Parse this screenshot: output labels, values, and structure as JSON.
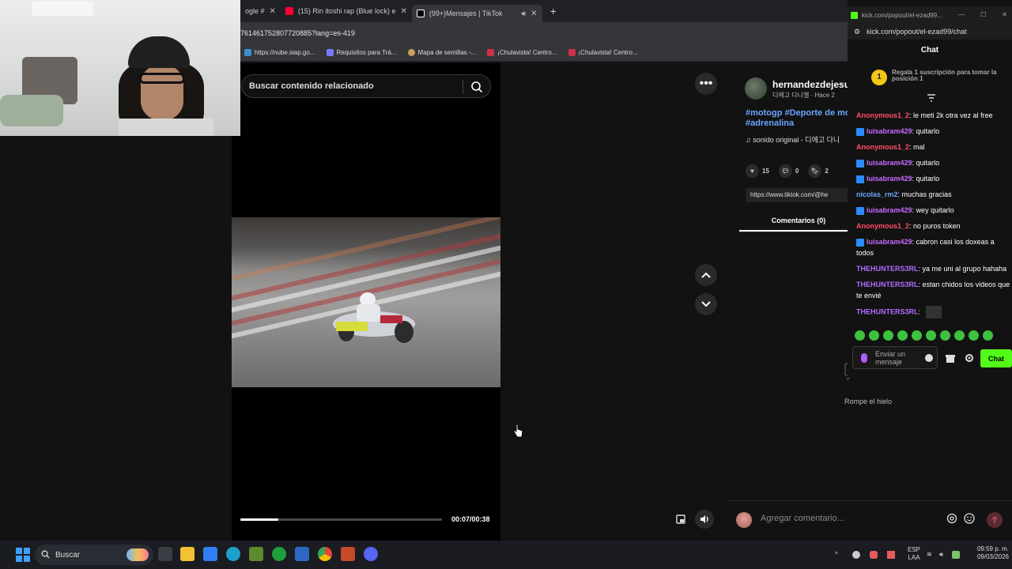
{
  "browser": {
    "tabs": [
      {
        "label": "ogle #",
        "icon": "google-icon",
        "color": "#4285f4"
      },
      {
        "label": "(15) Rin itoshi rap (Blue lock) e",
        "icon": "youtube-icon",
        "color": "#ff0033"
      },
      {
        "label": "(99+)Mensajes | TikTok",
        "icon": "tiktok-icon",
        "color": "#ffffff",
        "active": true
      }
    ],
    "url": "761461752807720885?lang=es-419",
    "bookmarks": [
      {
        "label": "https://nube.siap.go...",
        "color": "#3b8fd0"
      },
      {
        "label": "Requisitos para Trá...",
        "color": "#7a7aff"
      },
      {
        "label": "Mapa de semillas -...",
        "color": "#c8a25a"
      },
      {
        "label": "¡Chulavista! Centro...",
        "color": "#d0304a"
      },
      {
        "label": "¡Chulavista! Centro...",
        "color": "#d0304a"
      }
    ]
  },
  "video": {
    "search_placeholder": "Buscar contenido relacionado",
    "time": "00:07/00:38",
    "progress": 0.19
  },
  "post": {
    "username": "hernandezdejesu",
    "subtitle": "디에고 다니엘 · Hace 2",
    "tags": "#motogp #Deporte de mo #adrenalina",
    "sound": "sonido original - 디에고 다니",
    "likes": "15",
    "comments": "0",
    "saves": "2",
    "link": "https://www.tiktok.com/@he",
    "comments_tab": "Comentarios (0)",
    "empty_text": "Rompe el hielo",
    "comment_placeholder": "Agregar comentario..."
  },
  "kick": {
    "window_title": "kick.com/popout/el-ezad99...",
    "url": "kick.com/popout/el-ezad99/chat",
    "header": "Chat",
    "sub_promo": "Regala 1 suscripción para tomar la posición 1",
    "sub_badge": "1",
    "messages": [
      {
        "user": "Anonymous1_2",
        "color": "#ff4d6a",
        "badge": false,
        "text": "le meti 2k otra vez al free"
      },
      {
        "user": "luisabram429",
        "color": "#c86bff",
        "badge": true,
        "text": "quitarlo"
      },
      {
        "user": "Anonymous1_2",
        "color": "#ff4d6a",
        "badge": false,
        "text": "mal"
      },
      {
        "user": "luisabram429",
        "color": "#c86bff",
        "badge": true,
        "text": "quitarlo"
      },
      {
        "user": "luisabram429",
        "color": "#c86bff",
        "badge": true,
        "text": "quitarlo"
      },
      {
        "user": "nicolas_rm2",
        "color": "#6aa5ff",
        "badge": false,
        "text": "muchas gracias"
      },
      {
        "user": "luisabram429",
        "color": "#c86bff",
        "badge": true,
        "text": "wey quitarlo"
      },
      {
        "user": "Anonymous1_2",
        "color": "#ff4d6a",
        "badge": false,
        "text": "no puros token"
      },
      {
        "user": "luisabram429",
        "color": "#c86bff",
        "badge": true,
        "text": "cabron casi los doxeas a todos"
      },
      {
        "user": "THEHUNTERS3RL",
        "color": "#b06cff",
        "badge": false,
        "text": "ya me uni al grupo hahaha"
      },
      {
        "user": "THEHUNTERS3RL",
        "color": "#b06cff",
        "badge": false,
        "text": "estan chidos los videos que te envié"
      },
      {
        "user": "THEHUNTERS3RL",
        "color": "#b06cff",
        "badge": false,
        "text": ""
      }
    ],
    "input_placeholder": "Enviar un mensaje",
    "chat_button": "Chat"
  },
  "taskbar": {
    "search_label": "Buscar",
    "lang_top": "ESP",
    "lang_bottom": "LAA",
    "time": "09:59 p. m.",
    "date": "09/03/2026"
  }
}
